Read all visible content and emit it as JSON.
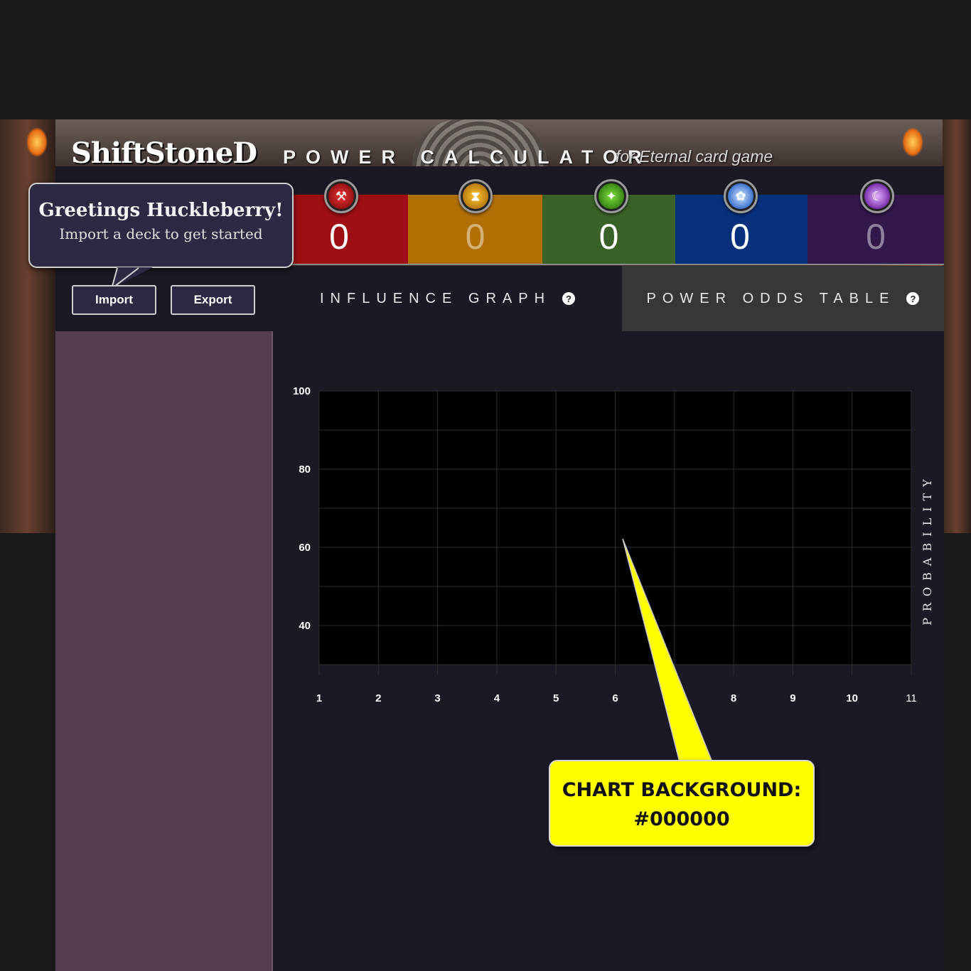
{
  "header": {
    "logo_text": "ShiftStoneD",
    "app_title": "POWER CALCULATOR",
    "app_subtitle": "for Eternal card game"
  },
  "greeting": {
    "title": "Greetings Huckleberry!",
    "subtitle": "Import a deck to get started"
  },
  "buttons": {
    "import_label": "Import",
    "export_label": "Export"
  },
  "influence": [
    {
      "faction": "fire",
      "icon": "hammer-icon",
      "value": "0",
      "color": "#9e0e13",
      "active": true
    },
    {
      "faction": "time",
      "icon": "hourglass-icon",
      "value": "0",
      "color": "#b17006",
      "active": false
    },
    {
      "faction": "justice",
      "icon": "wings-icon",
      "value": "0",
      "color": "#3a6128",
      "active": true
    },
    {
      "faction": "primal",
      "icon": "paw-icon",
      "value": "0",
      "color": "#04307c",
      "active": true
    },
    {
      "faction": "shadow",
      "icon": "crescent-icon",
      "value": "0",
      "color": "#32174b",
      "active": false
    }
  ],
  "tabs": {
    "influence_graph": "INFLUENCE GRAPH",
    "power_odds_table": "POWER ODDS TABLE",
    "help_glyph": "?"
  },
  "chart_data": {
    "type": "line",
    "background": "#000000",
    "xlim": [
      1,
      11
    ],
    "ylim": [
      30,
      100
    ],
    "x_ticks": [
      "1",
      "2",
      "3",
      "4",
      "5",
      "6",
      "8",
      "9",
      "10",
      "11"
    ],
    "y_ticks": [
      "100",
      "80",
      "60",
      "40"
    ],
    "ylabel": "PROBABILITY",
    "xlabel": "",
    "grid": true,
    "series": []
  },
  "annotation": {
    "line1": "CHART BACKGROUND:",
    "line2": "#000000",
    "color": "#ffff00"
  }
}
